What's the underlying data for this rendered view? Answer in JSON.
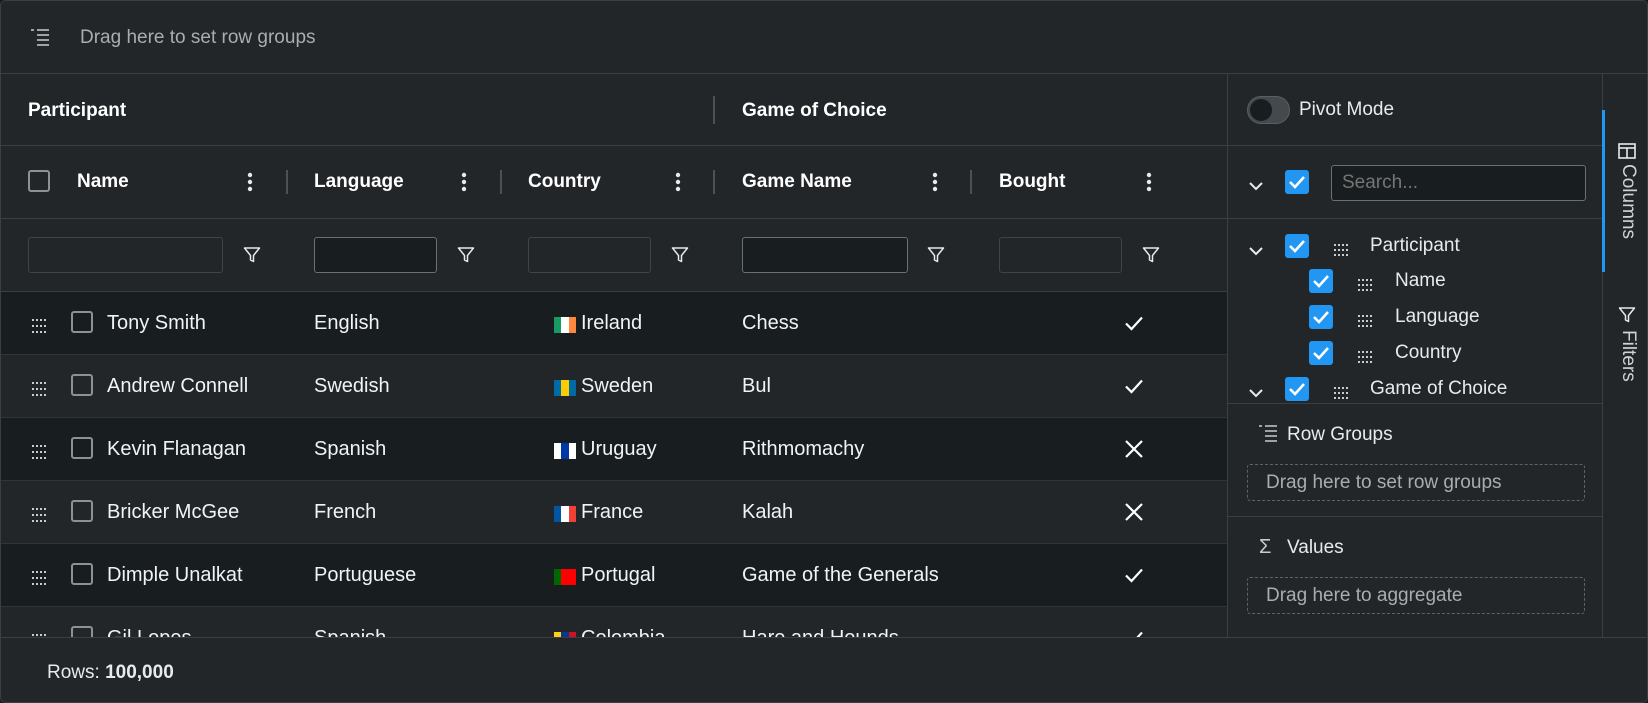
{
  "row_group_bar": {
    "label": "Drag here to set row groups"
  },
  "header_groups": {
    "participant": "Participant",
    "game": "Game of Choice"
  },
  "columns": {
    "name": "Name",
    "language": "Language",
    "country": "Country",
    "game_name": "Game Name",
    "bought": "Bought"
  },
  "rows": [
    {
      "name": "Tony Smith",
      "language": "English",
      "country": "Ireland",
      "game": "Chess",
      "bought": true,
      "flag": [
        "#169b62",
        "#ffffff",
        "#ff883e"
      ]
    },
    {
      "name": "Andrew Connell",
      "language": "Swedish",
      "country": "Sweden",
      "game": "Bul",
      "bought": true,
      "flag": [
        "#006aa7",
        "#fecc00",
        "#006aa7"
      ]
    },
    {
      "name": "Kevin Flanagan",
      "language": "Spanish",
      "country": "Uruguay",
      "game": "Rithmomachy",
      "bought": false,
      "flag": [
        "#ffffff",
        "#0038a8",
        "#ffffff"
      ]
    },
    {
      "name": "Bricker McGee",
      "language": "French",
      "country": "France",
      "game": "Kalah",
      "bought": false,
      "flag": [
        "#0055a4",
        "#ffffff",
        "#ef4135"
      ]
    },
    {
      "name": "Dimple Unalkat",
      "language": "Portuguese",
      "country": "Portugal",
      "game": "Game of the Generals",
      "bought": true,
      "flag": [
        "#006600",
        "#ff0000",
        "#ff0000"
      ]
    },
    {
      "name": "Gil Lopes",
      "language": "Spanish",
      "country": "Colombia",
      "game": "Hare and Hounds",
      "bought": true,
      "flag": [
        "#fcd116",
        "#003893",
        "#ce1126"
      ]
    }
  ],
  "side_panel": {
    "pivot_mode_label": "Pivot Mode",
    "search_placeholder": "Search...",
    "tree": {
      "participant": "Participant",
      "name": "Name",
      "language": "Language",
      "country": "Country",
      "game": "Game of Choice"
    },
    "row_groups_label": "Row Groups",
    "row_groups_drop": "Drag here to set row groups",
    "values_label": "Values",
    "values_drop": "Drag here to aggregate"
  },
  "tabs": {
    "columns": "Columns",
    "filters": "Filters"
  },
  "status": {
    "rows_label": "Rows:",
    "rows_value": "100,000"
  },
  "colors": {
    "accent": "#2196f3",
    "background": "#181d1f",
    "header": "#222628"
  }
}
